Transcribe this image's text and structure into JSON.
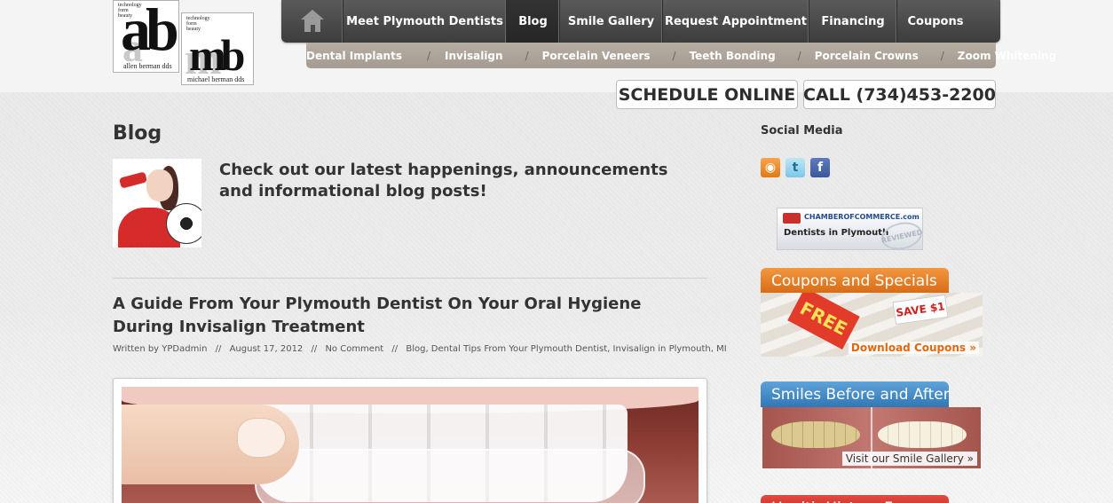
{
  "logo": {
    "motto_a": "technology\nform\nbeauty",
    "letters_a": "ab",
    "name_a": "allen berman dds",
    "motto_m": "technology\nform\nbeauty",
    "letters_m": "mb",
    "name_m": "michael berman dds"
  },
  "main_nav": {
    "home_icon": "home-icon",
    "items": [
      {
        "label": "Meet Plymouth Dentists"
      },
      {
        "label": "Blog",
        "active": true
      },
      {
        "label": "Smile Gallery"
      },
      {
        "label": "Request Appointment"
      },
      {
        "label": "Financing"
      },
      {
        "label": "Coupons"
      }
    ]
  },
  "sub_nav": {
    "separator": "/",
    "items": [
      {
        "label": "Dental Implants"
      },
      {
        "label": "Invisalign"
      },
      {
        "label": "Porcelain Veneers"
      },
      {
        "label": "Teeth Bonding"
      },
      {
        "label": "Porcelain Crowns"
      },
      {
        "label": "Zoom Whitening"
      }
    ]
  },
  "cta": {
    "schedule": "SCHEDULE ONLINE",
    "call": "CALL (734)453-2200"
  },
  "main": {
    "page_title": "Blog",
    "intro": "Check out our latest happenings, announcements and informational blog posts!",
    "post": {
      "title": "A Guide From Your Plymouth Dentist On Your Oral Hygiene During Invisalign Treatment",
      "author": "Written by YPDadmin",
      "date": "August 17, 2012",
      "comments": "No Comment",
      "categories": "Blog, Dental Tips From Your Plymouth Dentist, Invisalign in Plymouth, MI",
      "meta_sep": "//"
    }
  },
  "sidebar": {
    "social_title": "Social Media",
    "social_icons": [
      "rss-icon",
      "twitter-icon",
      "facebook-icon"
    ],
    "chamber": {
      "brand": "CHAMBEROFCOMMERCE.com",
      "label": "Dentists in Plymouth",
      "stamp": "REVIEWED"
    },
    "coupons": {
      "title": "Coupons and Specials",
      "free": "FREE",
      "save": "SAVE $1",
      "link": "Download Coupons »"
    },
    "smiles": {
      "title": "Smiles Before and After",
      "link": "Visit our Smile Gallery »"
    },
    "health": {
      "title": "Health History Form"
    }
  },
  "colors": {
    "nav_dark": "#3d3d3d",
    "subnav_tan": "#a59b90",
    "coupon_orange": "#d86b14",
    "smiles_blue": "#2f77b6",
    "health_red": "#b91f18"
  }
}
